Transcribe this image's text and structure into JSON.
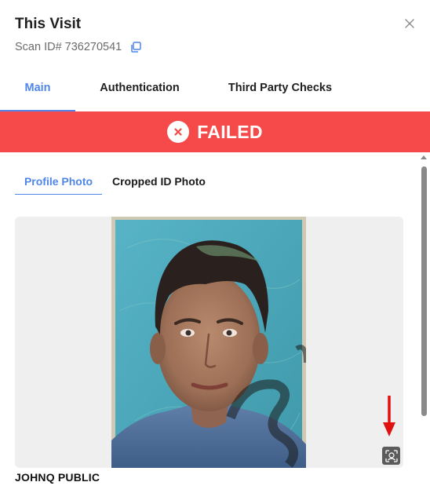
{
  "header": {
    "title": "This Visit",
    "scan_id_label": "Scan ID# 736270541"
  },
  "tabs": [
    {
      "label": "Main",
      "active": true
    },
    {
      "label": "Authentication",
      "active": false
    },
    {
      "label": "Third Party Checks",
      "active": false
    }
  ],
  "status": {
    "text": "FAILED",
    "color": "#f64a4a",
    "icon": "x-circle-icon"
  },
  "subtabs": [
    {
      "label": "Profile Photo",
      "active": true
    },
    {
      "label": "Cropped ID Photo",
      "active": false
    }
  ],
  "profile": {
    "name": "JOHNQ PUBLIC",
    "photo_icon": "face-scan-icon"
  },
  "colors": {
    "accent": "#4f86ea",
    "failed": "#f64a4a",
    "annotation_arrow": "#e01010"
  }
}
